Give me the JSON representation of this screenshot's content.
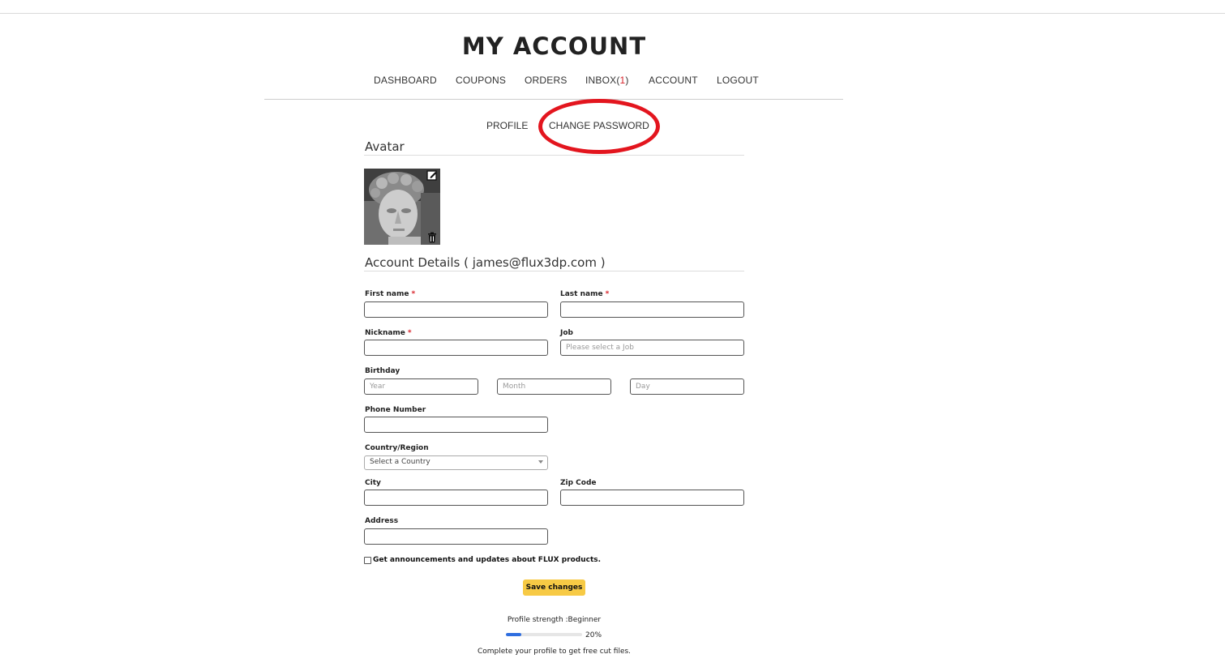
{
  "page": {
    "title": "MY ACCOUNT"
  },
  "nav": {
    "items": [
      {
        "id": "dashboard",
        "label": "DASHBOARD"
      },
      {
        "id": "coupons",
        "label": "COUPONS"
      },
      {
        "id": "orders",
        "label": "ORDERS"
      },
      {
        "id": "inbox",
        "label": "INBOX(",
        "count": "1",
        "suffix": ")"
      },
      {
        "id": "account",
        "label": "ACCOUNT"
      },
      {
        "id": "logout",
        "label": "LOGOUT"
      }
    ]
  },
  "subnav": {
    "profile": "PROFILE",
    "change_password": "CHANGE PASSWORD",
    "highlight_color": "#e3151e"
  },
  "avatar": {
    "heading": "Avatar",
    "edit_icon": "edit-icon",
    "delete_icon": "trash-icon"
  },
  "account": {
    "heading": "Account Details ( james@flux3dp.com )"
  },
  "form": {
    "first_name": {
      "label": "First name",
      "required": "*",
      "value": ""
    },
    "last_name": {
      "label": "Last name",
      "required": "*",
      "value": ""
    },
    "nickname": {
      "label": "Nickname",
      "required": "*",
      "value": ""
    },
    "job": {
      "label": "Job",
      "placeholder": "Please select a Job",
      "value": ""
    },
    "birthday": {
      "label": "Birthday",
      "year": {
        "placeholder": "Year"
      },
      "month": {
        "placeholder": "Month"
      },
      "day": {
        "placeholder": "Day"
      }
    },
    "phone": {
      "label": "Phone Number",
      "value": ""
    },
    "country": {
      "label": "Country/Region",
      "selected": "Select a Country"
    },
    "city": {
      "label": "City",
      "value": ""
    },
    "zip": {
      "label": "Zip Code",
      "value": ""
    },
    "address": {
      "label": "Address",
      "value": ""
    },
    "newsletter": {
      "label": "Get announcements and updates about FLUX products.",
      "checked": false
    },
    "save_label": "Save changes",
    "save_color": "#f7ca45",
    "required_color": "#d8232a"
  },
  "profile_strength": {
    "label": "Profile strength :Beginner",
    "percent": 20,
    "percent_text": "20%",
    "bar_color": "#2f6ee0",
    "hint": "Complete your profile to get free cut files."
  }
}
